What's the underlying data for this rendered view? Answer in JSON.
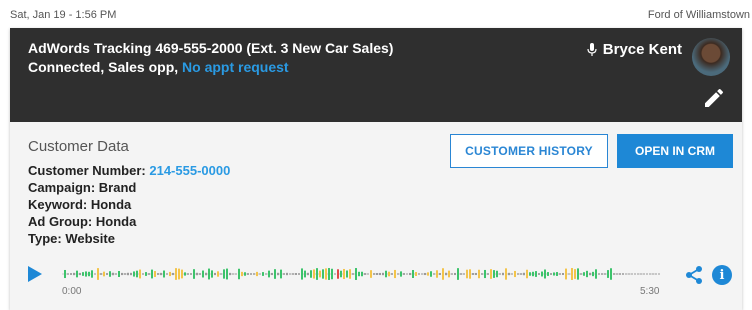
{
  "top": {
    "datetime": "Sat, Jan 19 - 1:56 PM",
    "dealer": "Ford of Williamstown"
  },
  "call": {
    "title": "AdWords Tracking 469-555-2000 (Ext. 3 New Car Sales)",
    "status_prefix": "Connected, Sales opp, ",
    "status_link": "No appt request",
    "agent_name": "Bryce Kent",
    "icons": [
      "microphone-icon",
      "avatar",
      "pencil-icon"
    ]
  },
  "customer": {
    "section_title": "Customer Data",
    "number_label": "Customer Number: ",
    "number_value": "214-555-0000",
    "campaign": "Campaign: Brand",
    "keyword": "Keyword: Honda",
    "ad_group": "Ad Group: Honda",
    "type": "Type: Website"
  },
  "actions": {
    "history_label": "CUSTOMER HISTORY",
    "crm_label": "OPEN IN CRM"
  },
  "player": {
    "start_time": "0:00",
    "end_time": "5:30",
    "icons": [
      "play-icon",
      "share-icon",
      "info-icon"
    ],
    "info_glyph": "i"
  },
  "colors": {
    "accent_blue": "#1e88d6",
    "link_blue": "#2a9ae3",
    "header_bg": "#2f2f2f",
    "wave_green": "#3cc36b",
    "wave_yellow": "#f3c44a",
    "wave_red": "#e04848",
    "wave_gray": "#9a9a9a"
  }
}
